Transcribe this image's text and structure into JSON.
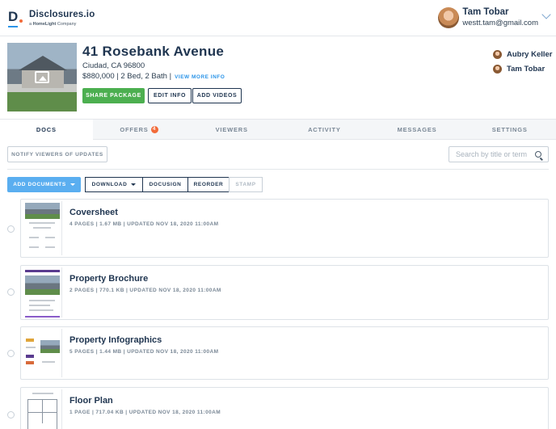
{
  "brand": {
    "name": "Disclosures.io",
    "mark": "D",
    "tagline_prefix": "a",
    "tagline_brand": "HomeLight",
    "tagline_suffix": "Company"
  },
  "user": {
    "name": "Tam Tobar",
    "email": "westt.tam@gmail.com"
  },
  "property": {
    "title": "41 Rosebank Avenue",
    "city": "Ciudad, CA 96800",
    "meta": "$880,000 | 2 Bed, 2 Bath |",
    "view_more": "VIEW MORE INFO"
  },
  "actions": {
    "share": "SHARE PACKAGE",
    "edit": "EDIT INFO",
    "videos": "ADD VIDEOS"
  },
  "agents": [
    {
      "name": "Aubry Keller"
    },
    {
      "name": "Tam Tobar"
    }
  ],
  "tabs": [
    {
      "label": "DOCS"
    },
    {
      "label": "OFFERS",
      "badge": "4"
    },
    {
      "label": "VIEWERS"
    },
    {
      "label": "ACTIVITY"
    },
    {
      "label": "MESSAGES"
    },
    {
      "label": "SETTINGS"
    }
  ],
  "toolbar": {
    "notify": "NOTIFY VIEWERS OF UPDATES",
    "search_placeholder": "Search by title or term",
    "add_documents": "ADD DOCUMENTS",
    "download": "DOWNLOAD",
    "docusign": "DOCUSIGN",
    "reorder": "REORDER",
    "stamp": "STAMP"
  },
  "documents": [
    {
      "title": "Coversheet",
      "meta": "4 PAGES | 1.67 MB | UPDATED NOV 18, 2020 11:00AM"
    },
    {
      "title": "Property Brochure",
      "meta": "2 PAGES | 770.1 KB | UPDATED NOV 18, 2020 11:00AM"
    },
    {
      "title": "Property Infographics",
      "meta": "5 PAGES | 1.44 MB | UPDATED NOV 18, 2020 11:00AM"
    },
    {
      "title": "Floor Plan",
      "meta": "1 PAGE | 717.04 KB | UPDATED NOV 18, 2020 11:00AM"
    }
  ],
  "colors": {
    "accent": "#2c95e8",
    "green": "#4caf50",
    "navy": "#1f3550",
    "orange": "#f26b3a"
  }
}
